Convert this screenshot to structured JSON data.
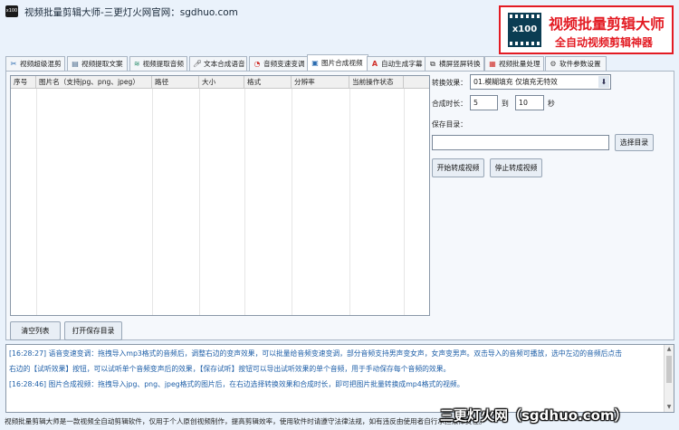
{
  "window": {
    "title": "视频批量剪辑大师-三更灯火网官网：sgdhuo.com",
    "icon_label": "x100"
  },
  "brand": {
    "badge": "x100",
    "line1": "视频批量剪辑大师",
    "line2": "全自动视频剪辑神器",
    "color": "#e31b23"
  },
  "tabs": [
    {
      "icon": "scissors-icon",
      "label": "视频超级混剪"
    },
    {
      "icon": "text-doc-icon",
      "label": "视频提取文案"
    },
    {
      "icon": "waveform-icon",
      "label": "视频提取音频"
    },
    {
      "icon": "microphone-icon",
      "label": "文本合成语音"
    },
    {
      "icon": "gauge-icon",
      "label": "音频变速变调"
    },
    {
      "icon": "image-icon",
      "label": "图片合成视频"
    },
    {
      "icon": "subtitle-a-icon",
      "label": "自动生成字幕"
    },
    {
      "icon": "orientation-icon",
      "label": "横屏竖屏转换"
    },
    {
      "icon": "film-icon",
      "label": "视频批量处理"
    },
    {
      "icon": "gear-icon",
      "label": "软件参数设置"
    }
  ],
  "active_tab": "图片合成视频",
  "table": {
    "columns": [
      "序号",
      "图片名（支持jpg、png、jpeg）",
      "路径",
      "大小",
      "格式",
      "分辨率",
      "当前操作状态"
    ],
    "rows": []
  },
  "form": {
    "effect_label": "转换效果：",
    "effect_value": "01.模糊填充 仅填充无特效",
    "duration_label": "合成时长：",
    "duration_from": "5",
    "duration_to_label": "到",
    "duration_to": "10",
    "duration_unit": "秒",
    "save_dir_label": "保存目录：",
    "save_dir_value": "",
    "choose_dir_button": "选择目录",
    "start_button": "开始转成视频",
    "stop_button": "停止转成视频"
  },
  "bottom_buttons": {
    "clear": "清空列表",
    "open_dir": "打开保存目录"
  },
  "log": [
    "[16:28:27] 语音变速变调：拖拽导入mp3格式的音频后，调整右边的变声效果，可以批量给音频变速变调，部分音频支持男声变女声，女声变男声。双击导入的音频可播放，选中左边的音频后点击",
    "右边的【试听效果】按钮，可以试听单个音频变声后的效果，【保存试听】按钮可以导出试听效果的单个音频，用于手动保存每个音频的效果。",
    "[16:28:46] 图片合成视频：拖拽导入jpg、png、jpeg格式的图片后，在右边选择转换效果和合成时长，即可把图片批量转换成mp4格式的视频。"
  ],
  "status_text": "视频批量剪辑大师是一款视频全自动剪辑软件，仅用于个人原创视频制作，提高剪辑效率，使用软件时请遵守法律法规，如有违反由使用者自行承担法律责任。",
  "watermark": "三更灯火网（sgdhuo.com）"
}
